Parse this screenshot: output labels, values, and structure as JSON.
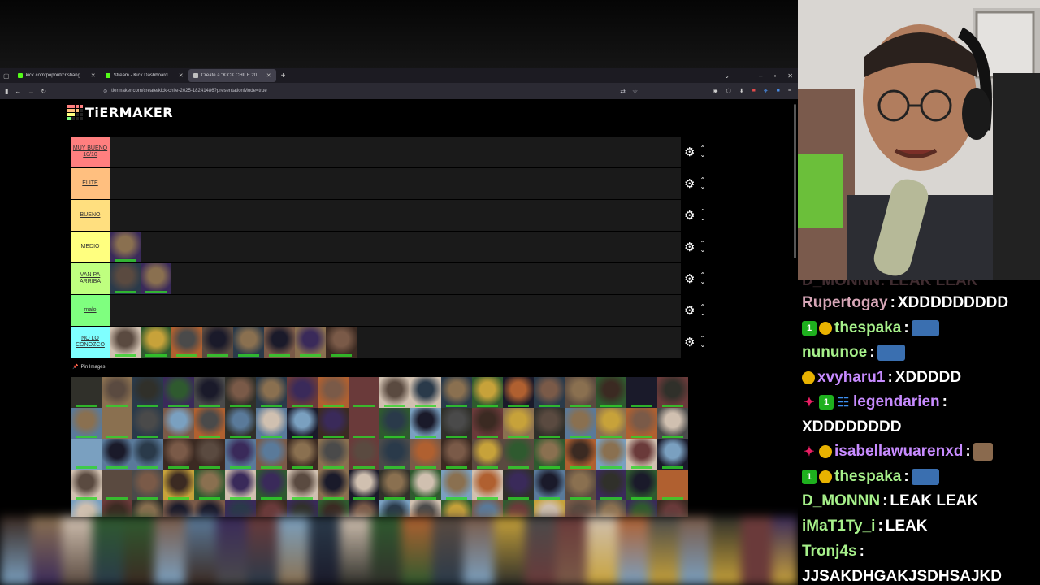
{
  "browser": {
    "tabs": [
      {
        "label": "kick.com/popout/cristianghost/",
        "favicon": "kick",
        "active": false
      },
      {
        "label": "Stream - Kick Dashboard",
        "favicon": "kick",
        "active": false
      },
      {
        "label": "Create a \"KICK CHILE 2025\" Tier",
        "favicon": "tiermaker",
        "active": true
      }
    ],
    "url": "tiermaker.com/create/kick-chile-2025-18241486?presentationMode=true"
  },
  "tiermaker": {
    "logo_text": "TiERMAKER",
    "tiers": [
      {
        "label": "MUY BUENO 10/10",
        "color": "#ff7f7f",
        "count": 0
      },
      {
        "label": "ELITE",
        "color": "#ffbf7f",
        "count": 0
      },
      {
        "label": "BUENO",
        "color": "#ffdf7f",
        "count": 0
      },
      {
        "label": "MEDIO",
        "color": "#ffff7f",
        "count": 1
      },
      {
        "label": "VAN PA ARRIBA",
        "color": "#bfff7f",
        "count": 2
      },
      {
        "label": "malo",
        "color": "#7fff7f",
        "count": 0
      },
      {
        "label": "NO LO CONOZCO",
        "color": "#7fffff",
        "count": 8
      }
    ],
    "pin_images_label": "Pin Images"
  },
  "chat": {
    "colors": {
      "rupert": "#d7a6b7",
      "green": "#a6f08a",
      "purple": "#c78bff"
    },
    "messages": [
      {
        "user": "D_MONNN",
        "text": "LEAK LEAK"
      },
      {
        "user": "Rupertogay",
        "text": "XDDDDDDDDD"
      },
      {
        "user": "thespaka",
        "text": ""
      },
      {
        "user": "nununoe",
        "text": ""
      },
      {
        "user": "xvyharu1",
        "text": "XDDDDD"
      },
      {
        "user": "legendarien",
        "text": "XDDDDDDDD"
      },
      {
        "user": "isabellawuarenxd",
        "text": ""
      },
      {
        "user": "thespaka",
        "text": ""
      },
      {
        "user": "D_MONNN",
        "text": "LEAK LEAK"
      },
      {
        "user": "iMaT1Ty_i",
        "text": "LEAK"
      },
      {
        "user": "Tronj4s",
        "text": "JJSAKDHGAKJSDHSAJKD"
      }
    ]
  }
}
